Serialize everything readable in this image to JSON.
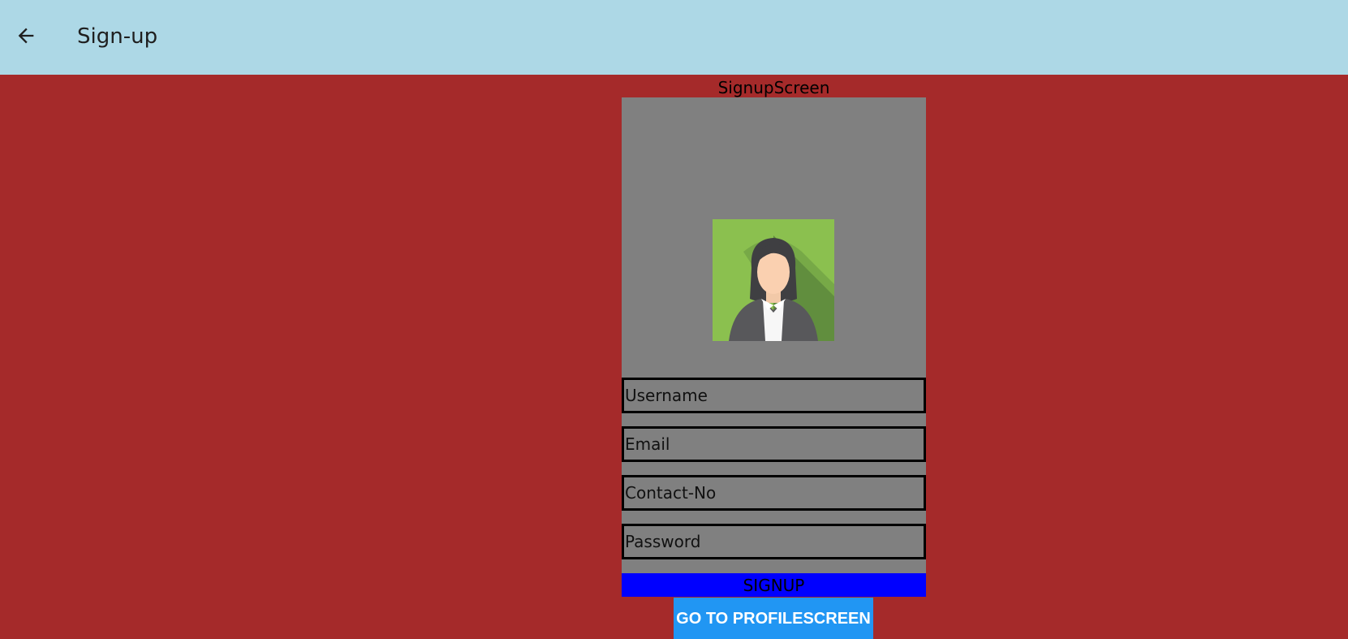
{
  "appbar": {
    "title": "Sign-up",
    "back_icon": "arrow-left-icon",
    "background": "#add8e6"
  },
  "page": {
    "background": "#a52a2a",
    "screen_label": "SignupScreen"
  },
  "form": {
    "panel_color": "#808080",
    "avatar_icon": "female-avatar-icon",
    "fields": [
      {
        "placeholder": "Username",
        "value": ""
      },
      {
        "placeholder": "Email",
        "value": ""
      },
      {
        "placeholder": "Contact-No",
        "value": ""
      },
      {
        "placeholder": "Password",
        "value": ""
      }
    ],
    "signup_label": "SIGNUP",
    "signup_color": "#0000ff"
  },
  "navigation": {
    "profile_button_label": "GO TO PROFILESCREEN",
    "profile_button_color": "#2196f3"
  }
}
